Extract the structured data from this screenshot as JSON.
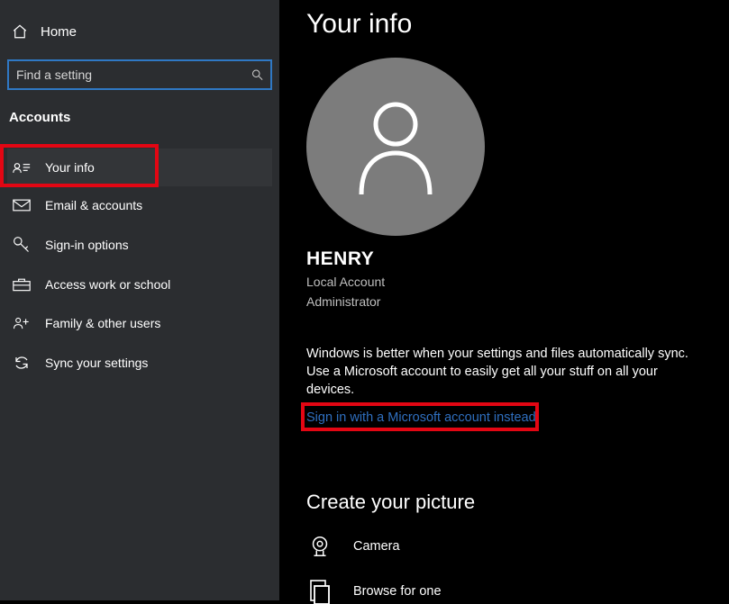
{
  "home_label": "Home",
  "search": {
    "placeholder": "Find a setting"
  },
  "section_title": "Accounts",
  "sidebar": {
    "items": [
      {
        "label": "Your info"
      },
      {
        "label": "Email & accounts"
      },
      {
        "label": "Sign-in options"
      },
      {
        "label": "Access work or school"
      },
      {
        "label": "Family & other users"
      },
      {
        "label": "Sync your settings"
      }
    ]
  },
  "page_title": "Your info",
  "user": {
    "name": "HENRY",
    "account_type": "Local Account",
    "role": "Administrator"
  },
  "sync_message": "Windows is better when your settings and files automatically sync. Use a Microsoft account to easily get all your stuff on all your devices.",
  "signin_link": "Sign in with a Microsoft account instead",
  "create_picture": {
    "title": "Create your picture",
    "camera": "Camera",
    "browse": "Browse for one"
  }
}
